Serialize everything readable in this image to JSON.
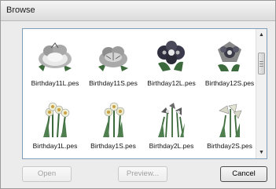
{
  "window": {
    "title": "Browse"
  },
  "files": [
    {
      "name": "Birthday11L.pes",
      "icon": "chrysanthemum-embroidery-icon"
    },
    {
      "name": "Birthday11S.pes",
      "icon": "chrysanthemum-embroidery-icon"
    },
    {
      "name": "Birthday12L.pes",
      "icon": "orchid-embroidery-icon"
    },
    {
      "name": "Birthday12S.pes",
      "icon": "orchid-embroidery-icon"
    },
    {
      "name": "Birthday1L.pes",
      "icon": "daffodil-embroidery-icon"
    },
    {
      "name": "Birthday1S.pes",
      "icon": "daffodil-embroidery-icon"
    },
    {
      "name": "Birthday2L.pes",
      "icon": "iris-embroidery-icon"
    },
    {
      "name": "Birthday2S.pes",
      "icon": "iris-embroidery-icon"
    }
  ],
  "buttons": {
    "open": {
      "label": "Open",
      "enabled": false
    },
    "preview": {
      "label": "Preview...",
      "enabled": false
    },
    "cancel": {
      "label": "Cancel",
      "enabled": true
    }
  },
  "scrollbar": {
    "up_icon": "scroll-up-arrow-icon",
    "down_icon": "scroll-down-arrow-icon"
  },
  "colors": {
    "chrysanthemum": "#8a8a8a",
    "orchid": "#2f2f40",
    "leaf": "#3c6a3c",
    "daffodil": "#e8e8c8"
  }
}
